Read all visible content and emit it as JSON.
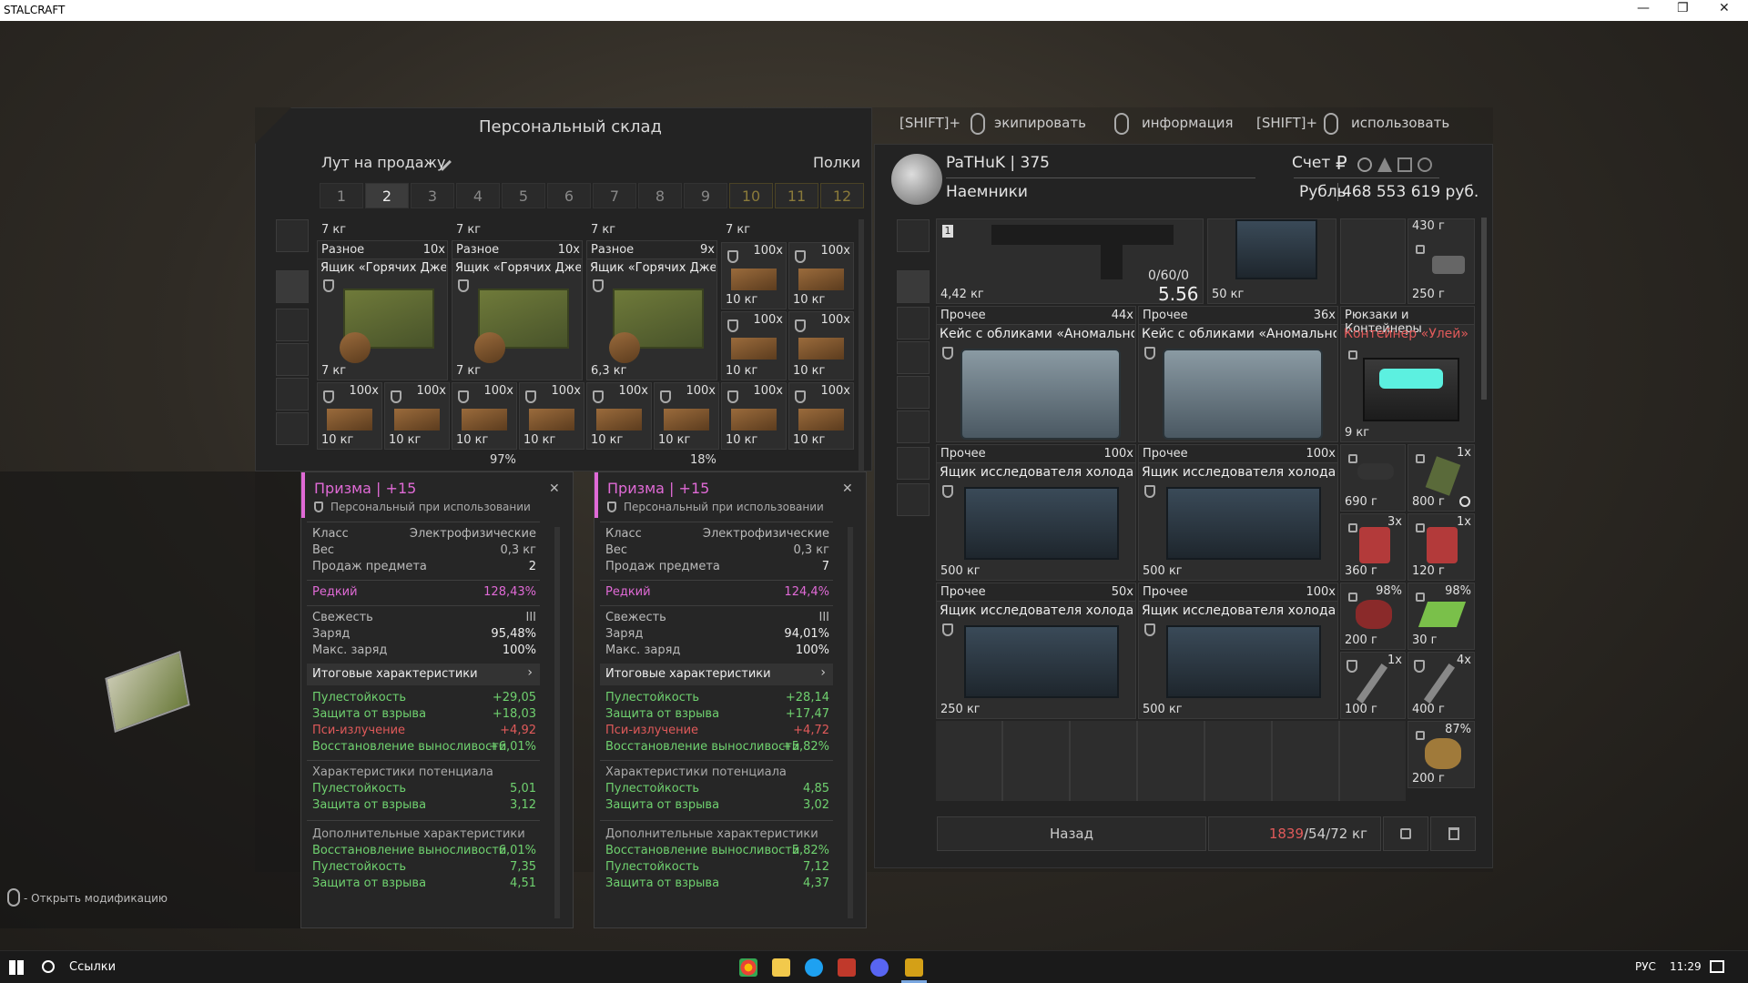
{
  "window": {
    "title": "STALCRAFT",
    "minimize": "—",
    "restore": "❐",
    "close": "✕"
  },
  "stash": {
    "title": "Персональный склад",
    "loot_label": "Лут на продажу",
    "shelves_label": "Полки",
    "tabs": [
      "1",
      "2",
      "3",
      "4",
      "5",
      "6",
      "7",
      "8",
      "9",
      "10",
      "11",
      "12"
    ],
    "top_weights": [
      "7 кг",
      "7 кг",
      "7 кг",
      "7 кг"
    ],
    "row1": [
      {
        "category": "Разное",
        "count": "10x",
        "name": "Ящик «Горячих Джек...",
        "weight": "7 кг"
      },
      {
        "category": "Разное",
        "count": "10x",
        "name": "Ящик «Горячих Джек...",
        "weight": "7 кг"
      },
      {
        "category": "Разное",
        "count": "9x",
        "name": "Ящик «Горячих Джек...",
        "weight": "6,3 кг"
      }
    ],
    "small": {
      "count": "100x",
      "weight": "10 кг"
    },
    "partial_pct": [
      "97%",
      "18%"
    ]
  },
  "hints": {
    "shift1": "[SHIFT]+",
    "equip": "экипировать",
    "info": "информация",
    "shift2": "[SHIFT]+",
    "use": "использовать"
  },
  "player": {
    "name": "PaTHuK | 375",
    "faction": "Наемники",
    "account_label": "Счет",
    "currency_label": "Рубль",
    "balance": "468 553 619 руб.",
    "currency_symbol": "₽"
  },
  "inventory": {
    "gun": {
      "ammo": "0/60/0",
      "caliber": "5.56",
      "weight": "4,42 кг"
    },
    "case_top": {
      "weight": "50 кг"
    },
    "side_top": {
      "w1": "430 г",
      "w2": "250 г"
    },
    "gun_slot_num": "1",
    "rows": [
      {
        "category": "Прочее",
        "count": "44x",
        "name": "Кейс с обликами «Аномального Б...",
        "weight": ""
      },
      {
        "category": "Прочее",
        "count": "36x",
        "name": "Кейс с обликами «Аномального Б...",
        "weight": ""
      },
      {
        "category": "Прочее",
        "count": "100x",
        "name": "Ящик исследователя холода",
        "weight": "500 кг"
      },
      {
        "category": "Прочее",
        "count": "100x",
        "name": "Ящик исследователя холода",
        "weight": "500 кг"
      },
      {
        "category": "Прочее",
        "count": "50x",
        "name": "Ящик исследователя холода",
        "weight": "250 кг"
      },
      {
        "category": "Прочее",
        "count": "100x",
        "name": "Ящик исследователя холода",
        "weight": "500 кг"
      }
    ],
    "backpack_category": "Рюкзаки и Контейнеры",
    "container_name": "Контейнер «Улей»",
    "container_weight": "9 кг",
    "side_items": [
      {
        "w": "690 г",
        "c": ""
      },
      {
        "w": "800 г",
        "c": "1x"
      },
      {
        "w": "360 г",
        "c": "3x"
      },
      {
        "w": "120 г",
        "c": "1x"
      },
      {
        "w": "200 г",
        "c": "98%"
      },
      {
        "w": "30 г",
        "c": "98%"
      },
      {
        "w": "100 г",
        "c": "1x"
      },
      {
        "w": "400 г",
        "c": "4x"
      },
      {
        "w": "200 г",
        "c": "87%"
      }
    ],
    "back_button": "Назад",
    "weight_current": "1839",
    "weight_rest": "/54/72 кг"
  },
  "tooltips": [
    {
      "title": "Призма | +15",
      "binding": "Персональный при использовании",
      "class_k": "Класс",
      "class_v": "Электрофизические",
      "weight_k": "Вес",
      "weight_v": "0,3 кг",
      "sale_k": "Продаж предмета",
      "sale_v": "2",
      "rarity_k": "Редкий",
      "rarity_v": "128,43%",
      "fresh_k": "Свежесть",
      "fresh_v": "III",
      "charge_k": "Заряд",
      "charge_v": "95,48%",
      "maxcharge_k": "Макс. заряд",
      "maxcharge_v": "100%",
      "final_label": "Итоговые характеристики",
      "arrow": "›",
      "s1_k": "Пулестойкость",
      "s1_v": "+29,05",
      "s2_k": "Защита от взрыва",
      "s2_v": "+18,03",
      "s3_k": "Пси-излучение",
      "s3_v": "+4,92",
      "s4_k": "Восстановление выносливости",
      "s4_v": "+6,01%",
      "pot_label": "Характеристики потенциала",
      "p1_k": "Пулестойкость",
      "p1_v": "5,01",
      "p2_k": "Защита от взрыва",
      "p2_v": "3,12",
      "add_label": "Дополнительные характеристики",
      "a1_k": "Восстановление выносливости",
      "a1_v": "6,01%",
      "a2_k": "Пулестойкость",
      "a2_v": "7,35",
      "a3_k": "Защита от взрыва",
      "a3_v": "4,51",
      "close": "✕"
    },
    {
      "title": "Призма | +15",
      "binding": "Персональный при использовании",
      "class_k": "Класс",
      "class_v": "Электрофизические",
      "weight_k": "Вес",
      "weight_v": "0,3 кг",
      "sale_k": "Продаж предмета",
      "sale_v": "7",
      "rarity_k": "Редкий",
      "rarity_v": "124,4%",
      "fresh_k": "Свежесть",
      "fresh_v": "III",
      "charge_k": "Заряд",
      "charge_v": "94,01%",
      "maxcharge_k": "Макс. заряд",
      "maxcharge_v": "100%",
      "final_label": "Итоговые характеристики",
      "arrow": "›",
      "s1_k": "Пулестойкость",
      "s1_v": "+28,14",
      "s2_k": "Защита от взрыва",
      "s2_v": "+17,47",
      "s3_k": "Пси-излучение",
      "s3_v": "+4,72",
      "s4_k": "Восстановление выносливости",
      "s4_v": "+5,82%",
      "pot_label": "Характеристики потенциала",
      "p1_k": "Пулестойкость",
      "p1_v": "4,85",
      "p2_k": "Защита от взрыва",
      "p2_v": "3,02",
      "add_label": "Дополнительные характеристики",
      "a1_k": "Восстановление выносливости",
      "a1_v": "5,82%",
      "a2_k": "Пулестойкость",
      "a2_v": "7,12",
      "a3_k": "Защита от взрыва",
      "a3_v": "4,37",
      "close": "✕"
    }
  ],
  "preview": {
    "hint": "- Открыть модификацию"
  },
  "taskbar": {
    "search": "Ссылки",
    "lang": "РУС",
    "time": "11:29"
  }
}
